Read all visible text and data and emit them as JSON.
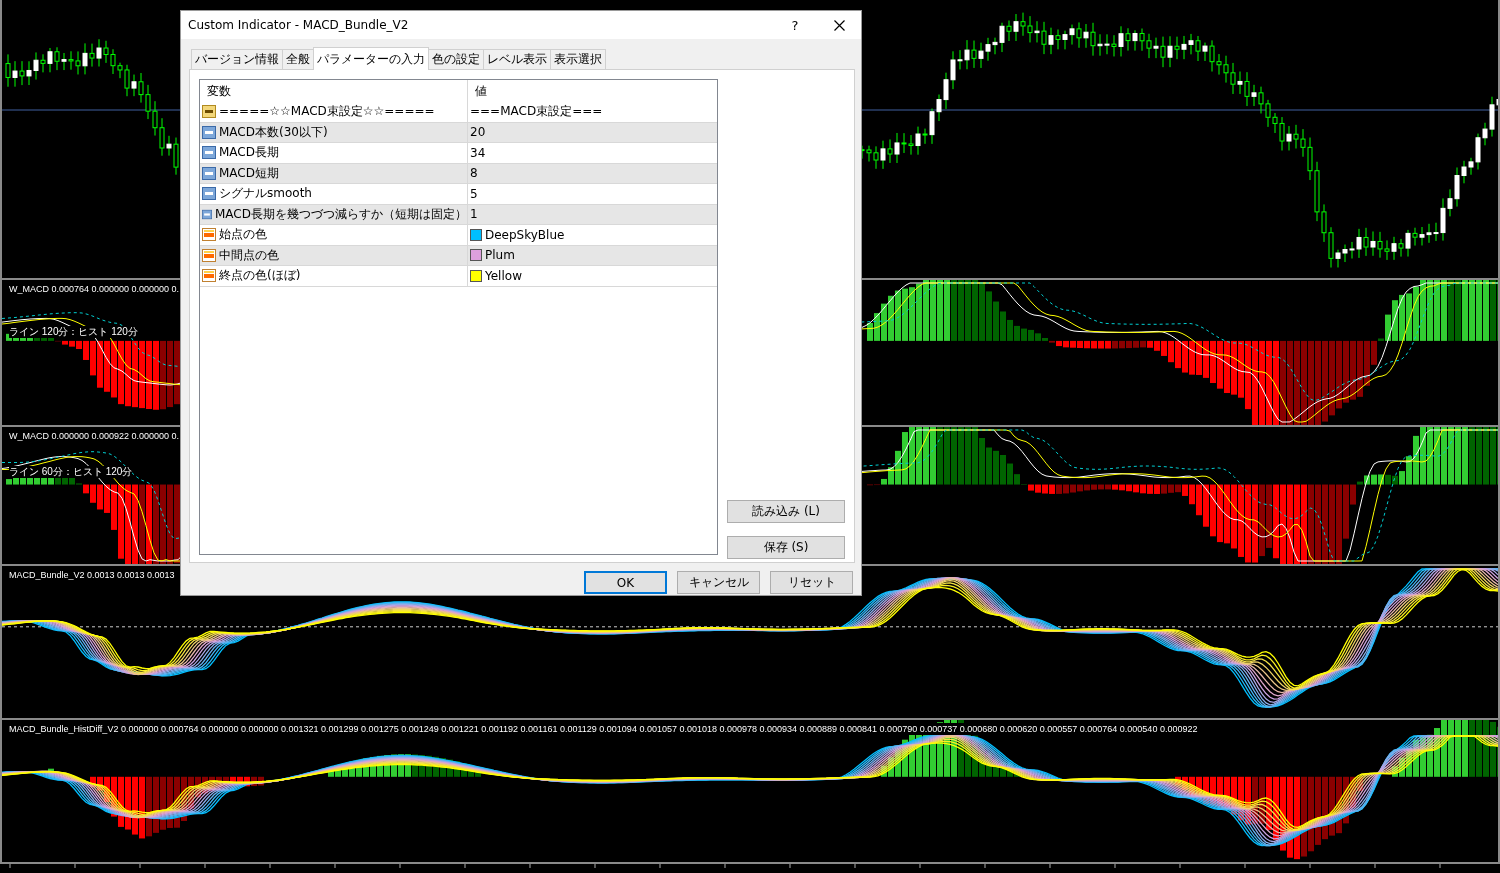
{
  "chart_panels": [
    {
      "kind": "price"
    },
    {
      "kind": "macd",
      "label": "W_MACD 0.000764 0.000000 0.000000 0.",
      "sublabel": "ライン  120分：ヒスト  120分"
    },
    {
      "kind": "macd",
      "label": "W_MACD 0.000000 0.000922 0.000000 0.",
      "sublabel": "ライン  60分：ヒスト  120分"
    },
    {
      "kind": "bundle",
      "label": "MACD_Bundle_V2 0.0013 0.0013 0.0013"
    },
    {
      "kind": "histdiff",
      "label": "MACD_Bundle_HistDiff_V2 0.000000 0.000764 0.000000 0.000000 0.001321 0.001299 0.001275 0.001249 0.001221 0.001192 0.001161 0.001129 0.001094 0.001057 0.001018 0.000978 0.000934 0.000889 0.000841 0.000790 0.000737 0.000680 0.000620 0.000557 0.000764 0.000540 0.000922"
    }
  ],
  "dialog": {
    "title": "Custom Indicator - MACD_Bundle_V2",
    "help": "?",
    "tabs": [
      {
        "label": "バージョン情報",
        "selected": false
      },
      {
        "label": "全般",
        "selected": false
      },
      {
        "label": "パラメーターの入力",
        "selected": true
      },
      {
        "label": "色の設定",
        "selected": false
      },
      {
        "label": "レベル表示",
        "selected": false
      },
      {
        "label": "表示選択",
        "selected": false
      }
    ],
    "columns": [
      "変数",
      "値"
    ],
    "rows": [
      {
        "kind": "string",
        "name": "=====☆☆MACD束設定☆☆=====",
        "value": "===MACD束設定==="
      },
      {
        "kind": "number",
        "name": "MACD本数(30以下)",
        "value": "20"
      },
      {
        "kind": "number",
        "name": "MACD長期",
        "value": "34"
      },
      {
        "kind": "number",
        "name": "MACD短期",
        "value": "8"
      },
      {
        "kind": "number",
        "name": "シグナルsmooth",
        "value": "5"
      },
      {
        "kind": "number",
        "name": "MACD長期を幾つづつ減らすか（短期は固定）",
        "value": "1"
      },
      {
        "kind": "color",
        "name": "始点の色",
        "value": "DeepSkyBlue",
        "color": "#00bfff"
      },
      {
        "kind": "color",
        "name": "中間点の色",
        "value": "Plum",
        "color": "#dda0dd"
      },
      {
        "kind": "color",
        "name": "終点の色(ほぼ)",
        "value": "Yellow",
        "color": "#ffff00"
      }
    ],
    "side_buttons": [
      "読み込み (L)",
      "保存 (S)"
    ],
    "footer_buttons": [
      {
        "label": "OK",
        "default": true
      },
      {
        "label": "キャンセル",
        "default": false
      },
      {
        "label": "リセット",
        "default": false
      }
    ]
  }
}
